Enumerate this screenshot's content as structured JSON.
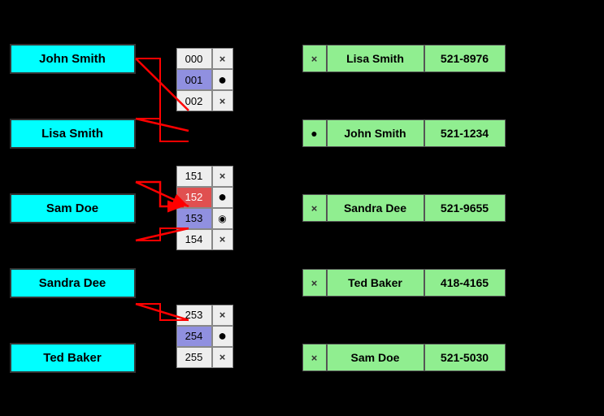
{
  "persons": [
    {
      "id": "john-smith",
      "name": "John Smith"
    },
    {
      "id": "lisa-smith",
      "name": "Lisa Smith"
    },
    {
      "id": "sam-doe",
      "name": "Sam Doe"
    },
    {
      "id": "sandra-dee",
      "name": "Sandra Dee"
    },
    {
      "id": "ted-baker",
      "name": "Ted Baker"
    }
  ],
  "buckets": [
    {
      "group": "group-000",
      "rows": [
        {
          "num": "000",
          "icon": "x",
          "highlight": ""
        },
        {
          "num": "001",
          "icon": "dot",
          "highlight": "blue"
        },
        {
          "num": "002",
          "icon": "x",
          "highlight": ""
        }
      ]
    },
    {
      "group": "group-151",
      "rows": [
        {
          "num": "151",
          "icon": "x",
          "highlight": ""
        },
        {
          "num": "152",
          "icon": "dot",
          "highlight": "red"
        },
        {
          "num": "153",
          "icon": "dot-small",
          "highlight": "blue"
        },
        {
          "num": "154",
          "icon": "x",
          "highlight": ""
        }
      ]
    },
    {
      "group": "group-253",
      "rows": [
        {
          "num": "253",
          "icon": "x",
          "highlight": ""
        },
        {
          "num": "254",
          "icon": "dot",
          "highlight": "blue"
        },
        {
          "num": "255",
          "icon": "x",
          "highlight": ""
        }
      ]
    }
  ],
  "results": [
    {
      "icon": "x",
      "name": "Lisa Smith",
      "phone": "521-8976"
    },
    {
      "icon": "dot",
      "name": "John Smith",
      "phone": "521-1234"
    },
    {
      "icon": "x",
      "name": "Sandra Dee",
      "phone": "521-9655"
    },
    {
      "icon": "x",
      "name": "Ted Baker",
      "phone": "418-4165"
    },
    {
      "icon": "x",
      "name": "Sam Doe",
      "phone": "521-5030"
    }
  ],
  "icons": {
    "x": "×",
    "dot": "●",
    "dot-small": "◉"
  }
}
